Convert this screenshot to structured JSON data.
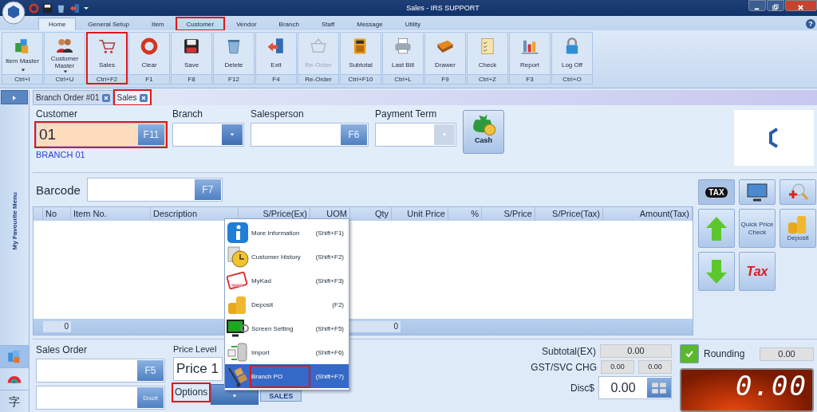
{
  "window": {
    "title": "Sales - IRS SUPPORT",
    "help_glyph": "?"
  },
  "ribbon_tabs": [
    {
      "label": "Home",
      "selected": true,
      "highlighted": false
    },
    {
      "label": "General Setup",
      "selected": false,
      "highlighted": false
    },
    {
      "label": "Item",
      "selected": false,
      "highlighted": false
    },
    {
      "label": "Customer",
      "selected": false,
      "highlighted": true
    },
    {
      "label": "Vendor",
      "selected": false,
      "highlighted": false
    },
    {
      "label": "Branch",
      "selected": false,
      "highlighted": false
    },
    {
      "label": "Staff",
      "selected": false,
      "highlighted": false
    },
    {
      "label": "Message",
      "selected": false,
      "highlighted": false
    },
    {
      "label": "Utility",
      "selected": false,
      "highlighted": false
    }
  ],
  "ribbon_buttons": [
    {
      "label": "Item Master",
      "shortcut": "Ctrl+I",
      "dropdown": true,
      "disabled": false,
      "highlighted": false
    },
    {
      "label": "Customer Master",
      "shortcut": "Ctrl+U",
      "dropdown": true,
      "disabled": false,
      "highlighted": false
    },
    {
      "label": "Sales",
      "shortcut": "Ctrl+F2",
      "dropdown": false,
      "disabled": false,
      "highlighted": true
    },
    {
      "label": "Clear",
      "shortcut": "F1",
      "dropdown": false,
      "disabled": false,
      "highlighted": false
    },
    {
      "label": "Save",
      "shortcut": "F8",
      "dropdown": false,
      "disabled": false,
      "highlighted": false
    },
    {
      "label": "Delete",
      "shortcut": "F12",
      "dropdown": false,
      "disabled": false,
      "highlighted": false
    },
    {
      "label": "Exit",
      "shortcut": "F4",
      "dropdown": false,
      "disabled": false,
      "highlighted": false
    },
    {
      "label": "Re-Order",
      "shortcut": "Re-Order",
      "dropdown": false,
      "disabled": true,
      "highlighted": false
    },
    {
      "label": "Subtotal",
      "shortcut": "Ctrl+F10",
      "dropdown": false,
      "disabled": false,
      "highlighted": false
    },
    {
      "label": "Last Bill",
      "shortcut": "Ctrl+L",
      "dropdown": false,
      "disabled": false,
      "highlighted": false
    },
    {
      "label": "Drawer",
      "shortcut": "F9",
      "dropdown": false,
      "disabled": false,
      "highlighted": false
    },
    {
      "label": "Check",
      "shortcut": "Ctrl+Z",
      "dropdown": false,
      "disabled": false,
      "highlighted": false
    },
    {
      "label": "Report",
      "shortcut": "F3",
      "dropdown": false,
      "disabled": false,
      "highlighted": false
    },
    {
      "label": "Log Off",
      "shortcut": "Ctrl+O",
      "dropdown": false,
      "disabled": false,
      "highlighted": false
    }
  ],
  "left_bar": {
    "title": "My Favourite Menu",
    "language_glyph": "字"
  },
  "doc_tabs": [
    {
      "label": "Branch Order #01",
      "selected": false,
      "highlighted": false
    },
    {
      "label": "Sales",
      "selected": true,
      "highlighted": true
    }
  ],
  "customer": {
    "label": "Customer",
    "value": "01",
    "key": "F11",
    "highlighted": true,
    "branch_name": "BRANCH 01"
  },
  "branch": {
    "label": "Branch"
  },
  "salesperson": {
    "label": "Salesperson",
    "key": "F6"
  },
  "payment_term": {
    "label": "Payment Term",
    "disabled": true
  },
  "cash_button": {
    "label": "Cash"
  },
  "barcode": {
    "label": "Barcode",
    "key": "F7"
  },
  "table": {
    "columns": [
      "No",
      "Item No.",
      "Description",
      "S/Price(Ex)",
      "UOM",
      "Qty",
      "Unit Price",
      "%",
      "S/Price",
      "S/Price(Tax)",
      "Amount(Tax)"
    ],
    "footer": [
      "0",
      "0"
    ]
  },
  "side_buttons": [
    {
      "kind": "tax-badge",
      "label": "TAX"
    },
    {
      "kind": "monitor"
    },
    {
      "kind": "magnifier"
    },
    {
      "kind": "arrow-up"
    },
    {
      "kind": "text",
      "label": "Quick Price Check"
    },
    {
      "kind": "coins",
      "label": "Deposit"
    },
    {
      "kind": "arrow-down"
    },
    {
      "kind": "red-text",
      "label": "Tax"
    }
  ],
  "options_menu": {
    "items": [
      {
        "label": "More Information",
        "shortcut": "(Shift+F1)",
        "selected": false,
        "highlighted": false
      },
      {
        "label": "Customer History",
        "shortcut": "(Shift+F2)",
        "selected": false,
        "highlighted": false
      },
      {
        "label": "MyKad",
        "shortcut": "(Shift+F3)",
        "selected": false,
        "highlighted": false
      },
      {
        "label": "Deposit",
        "shortcut": "(F2)",
        "selected": false,
        "highlighted": false
      },
      {
        "label": "Screen Setting",
        "shortcut": "(Shift+F5)",
        "selected": false,
        "highlighted": false
      },
      {
        "label": "Import",
        "shortcut": "(Shift+F6)",
        "selected": false,
        "highlighted": false
      },
      {
        "label": "Branch PO",
        "shortcut": "(Shift+F7)",
        "selected": true,
        "highlighted": true
      }
    ]
  },
  "sales_order": {
    "label": "Sales Order",
    "key": "F5",
    "doc_key": "Doc#"
  },
  "price_level": {
    "label": "Price Level",
    "value": "Price 1"
  },
  "options": {
    "label": "Options",
    "highlighted": true
  },
  "mode_badge": "SALES",
  "totals": {
    "subtotal_label": "Subtotal(EX)",
    "subtotal": "0.00",
    "charge_label": "GST/SVC CHG",
    "gst": "0.00",
    "svc": "0.00",
    "disc_label": "Disc$",
    "disc": "0.00"
  },
  "rounding": {
    "label": "Rounding",
    "checked": true,
    "value": "0.00"
  },
  "display": "0.00"
}
